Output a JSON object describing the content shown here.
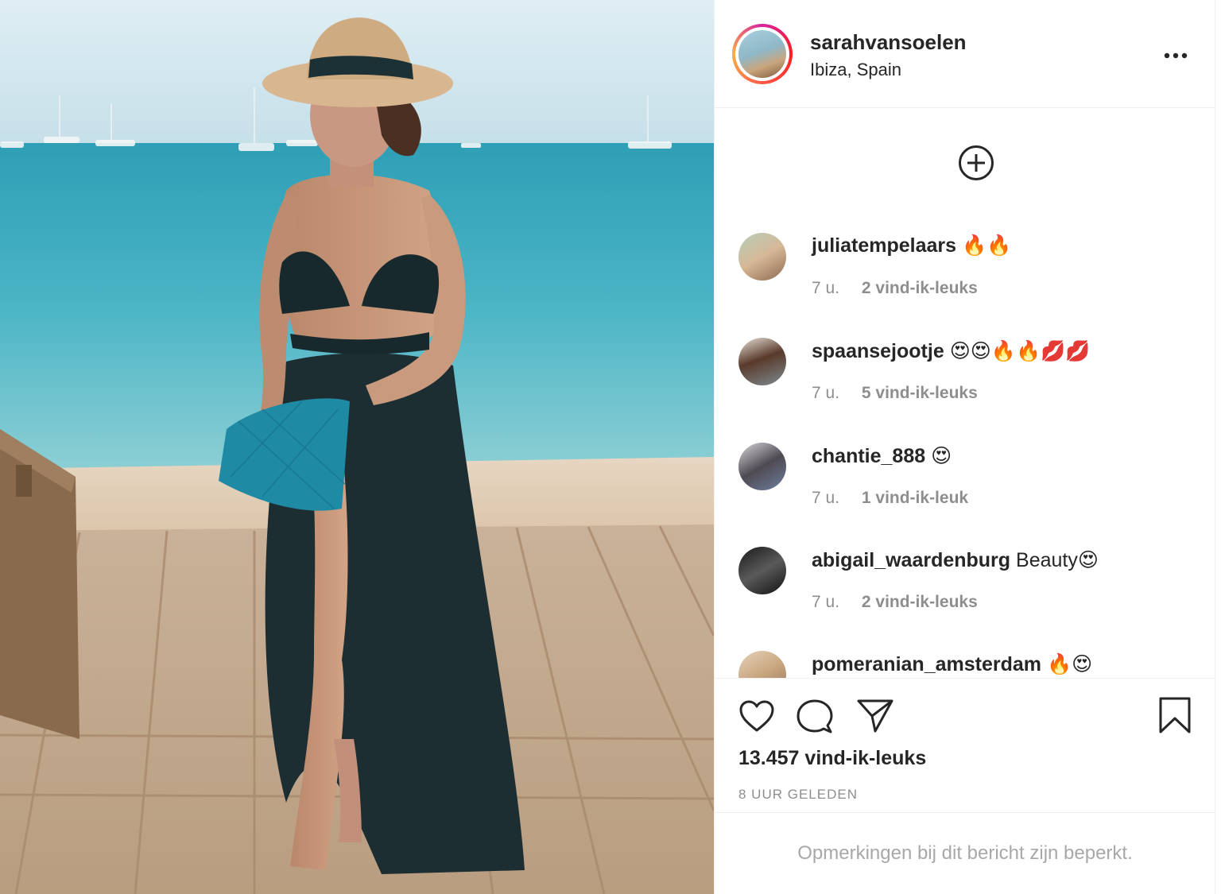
{
  "post": {
    "username": "sarahvansoelen",
    "location": "Ibiza, Spain",
    "more_icon": "ellipsis-icon",
    "load_more_icon": "plus-circle-icon"
  },
  "comments": [
    {
      "user": "juliatempelaars",
      "text": "",
      "emoji": "🔥🔥",
      "time": "7 u.",
      "likes": "2 vind-ik-leuks"
    },
    {
      "user": "spaansejootje",
      "text": "",
      "emoji": "😍😍🔥🔥💋💋",
      "time": "7 u.",
      "likes": "5 vind-ik-leuks"
    },
    {
      "user": "chantie_888",
      "text": "",
      "emoji": "😍",
      "time": "7 u.",
      "likes": "1 vind-ik-leuk"
    },
    {
      "user": "abigail_waardenburg",
      "text": "Beauty",
      "emoji": "😍",
      "time": "7 u.",
      "likes": "2 vind-ik-leuks"
    },
    {
      "user": "pomeranian_amsterdam",
      "text": "",
      "emoji": "🔥😍",
      "time": "",
      "likes": ""
    }
  ],
  "actions": {
    "like_icon": "heart-icon",
    "comment_icon": "comment-bubble-icon",
    "share_icon": "paper-plane-icon",
    "save_icon": "bookmark-icon",
    "likes_count": "13.457 vind-ik-leuks",
    "timestamp": "8 UUR GELEDEN"
  },
  "footer": {
    "restricted_note": "Opmerkingen bij dit bericht zijn beperkt."
  },
  "colors": {
    "text": "#262626",
    "muted": "#8e8e8e",
    "border": "#efefef",
    "placeholder": "#a8a8a8"
  }
}
